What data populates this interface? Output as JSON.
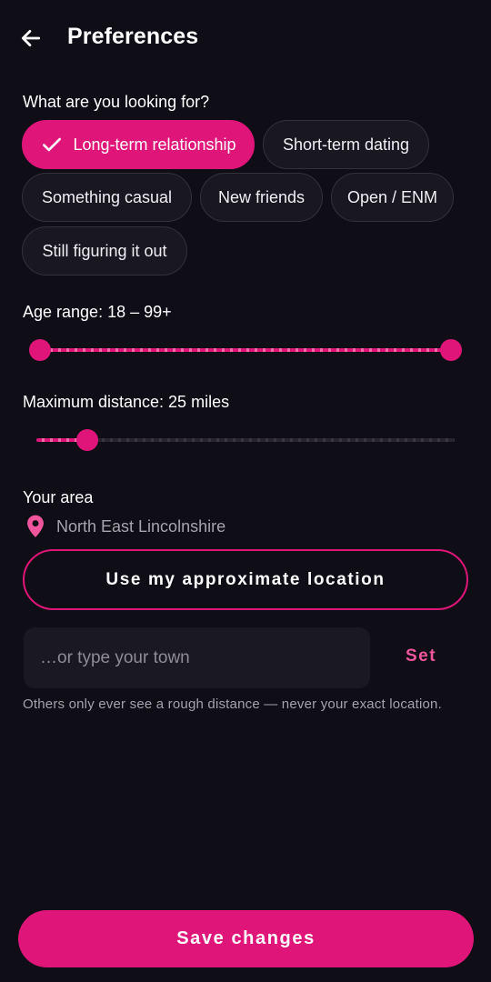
{
  "header": {
    "back_icon": "arrow-left-icon",
    "title": "Preferences"
  },
  "looking_for": {
    "label": "What are you looking for?",
    "options": [
      {
        "label": "Long-term relationship",
        "selected": true
      },
      {
        "label": "Short-term dating",
        "selected": false
      },
      {
        "label": "Something casual",
        "selected": false
      },
      {
        "label": "New friends",
        "selected": false
      },
      {
        "label": "Open / ENM",
        "selected": false
      },
      {
        "label": "Still figuring it out",
        "selected": false
      }
    ]
  },
  "age_range": {
    "label": "Age range: 18 – 99+",
    "min": 18,
    "max": 99,
    "low_value": 18,
    "high_value": 99
  },
  "distance": {
    "label": "Maximum distance: 25 miles",
    "min": 1,
    "max": 250,
    "value": 25
  },
  "area": {
    "label": "Your area",
    "icon": "location-pin-icon",
    "current": "North East Lincolnshire",
    "use_location_label": "Use my approximate location",
    "town_placeholder": "…or type your town",
    "town_value": "",
    "set_label": "Set",
    "privacy_note": "Others only ever see a rough distance — never your exact location."
  },
  "save_label": "Save changes",
  "colors": {
    "background": "#0f0d15",
    "accent": "#e0157a",
    "accent_text": "#f0559d",
    "chip_bg": "#19171f",
    "muted_text": "#a7a3b1"
  }
}
